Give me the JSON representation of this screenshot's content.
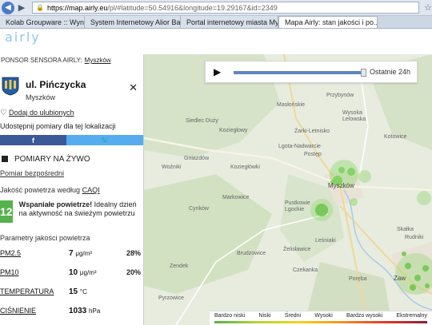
{
  "browser": {
    "url_host": "https://map.airly.eu",
    "url_rest": "/pl/#latitude=50.54916&longitude=19.29167&id=2349",
    "tabs": [
      {
        "label": "Kolab Groupware :: Wyniki wys...",
        "color": "#3c7fc0"
      },
      {
        "label": "System Internetowy Alior Bank...",
        "color": "#c62b2b"
      },
      {
        "label": "Portal internetowy miasta Mys...",
        "color": "#e0842b"
      },
      {
        "label": "Mapa Airly: stan jakości i po...",
        "color": "#4db3e3"
      }
    ]
  },
  "logo": {
    "text": "airly"
  },
  "sidebar": {
    "sponsor_label": "ponsor sensora Airly:",
    "sponsor_link": "Myszków",
    "station_name": "ul. Pińczycka",
    "station_city": "Myszków",
    "favorite_link": "Dodaj do ulubionych",
    "share_label": "Udostępnij pomiary dla tej lokalizacji",
    "facebook_label": "f",
    "twitter_label": "🐦",
    "live_title": "POMIARY NA ŻYWO",
    "live_sub": "Pomiar bezpośredni",
    "caqi_label": "Jakość powietrza według",
    "caqi_link": "CAQI",
    "aqi_value": "12",
    "aqi_headline": "Wspaniałe powietrze!",
    "aqi_text": "Idealny dzień na aktywność na świeżym powietrzu",
    "params_title": "Parametry jakości powietrza",
    "params": [
      {
        "name": "PM2.5",
        "value": "7",
        "unit": "μg/m³",
        "pct": "28%"
      },
      {
        "name": "PM10",
        "value": "10",
        "unit": "μg/m³",
        "pct": "20%"
      },
      {
        "name": "Temperatura",
        "value": "15",
        "unit": "°C",
        "pct": ""
      },
      {
        "name": "Ciśnienie",
        "value": "1033",
        "unit": "hPa",
        "pct": ""
      }
    ]
  },
  "player": {
    "label": "Ostatnie 24h",
    "progress": 1.0
  },
  "map": {
    "places": [
      {
        "name": "Masłońskie"
      },
      {
        "name": "Przybynów"
      },
      {
        "name": "Siedlec Duży"
      },
      {
        "name": "Żarki-Letnisko"
      },
      {
        "name": "Wysoka Lelowska"
      },
      {
        "name": "Kotowice"
      },
      {
        "name": "Koziegłowy"
      },
      {
        "name": "Lgota-Nadwarcie"
      },
      {
        "name": "Gniazdów"
      },
      {
        "name": "Postęp"
      },
      {
        "name": "Woźniki"
      },
      {
        "name": "Koziegłówki"
      },
      {
        "name": "Myszków"
      },
      {
        "name": "Markowice"
      },
      {
        "name": "Pustkowie Lgockie"
      },
      {
        "name": "Cynków"
      },
      {
        "name": "Skałka"
      },
      {
        "name": "Rudniki"
      },
      {
        "name": "Leśniaki"
      },
      {
        "name": "Żelisławice"
      },
      {
        "name": "Brudzowice"
      },
      {
        "name": "Zendek"
      },
      {
        "name": "Czekanka"
      },
      {
        "name": "Poręba"
      },
      {
        "name": "Pyrzowice"
      },
      {
        "name": "Zaw"
      }
    ]
  },
  "legend": {
    "labels": [
      "Bardzo niski",
      "Niski",
      "Średni",
      "Wysoki",
      "Bardzo wysoki",
      "Ekstremalny"
    ]
  }
}
